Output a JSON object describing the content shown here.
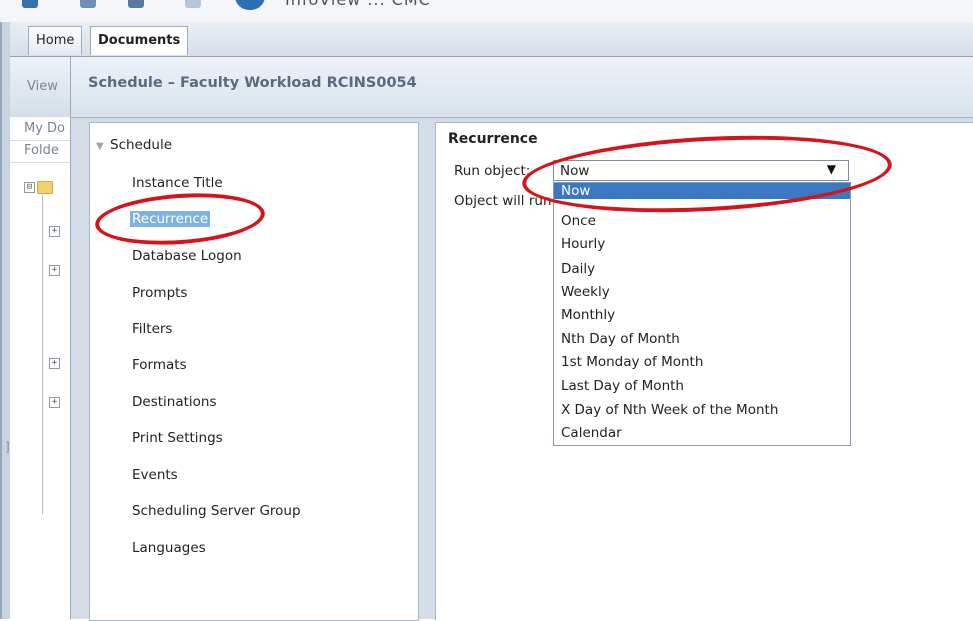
{
  "toolbar": {
    "app_title": "InfoView ... CMC"
  },
  "tabs": [
    {
      "label": "Home"
    },
    {
      "label": "Documents"
    }
  ],
  "docs_panel": {
    "view_label": "View",
    "my_documents": "My Do",
    "folders": "Folde",
    "expand_symbol": "⊟",
    "plus_symbol": "+"
  },
  "header": {
    "title": "Schedule – Faculty Workload RCINS0054"
  },
  "nav": {
    "root": "Schedule",
    "items": [
      {
        "label": "Instance Title"
      },
      {
        "label": "Recurrence",
        "selected": true
      },
      {
        "label": "Database Logon"
      },
      {
        "label": "Prompts"
      },
      {
        "label": "Filters"
      },
      {
        "label": "Formats"
      },
      {
        "label": "Destinations"
      },
      {
        "label": "Print Settings"
      },
      {
        "label": "Events"
      },
      {
        "label": "Scheduling Server Group"
      },
      {
        "label": "Languages"
      }
    ]
  },
  "recurrence": {
    "title": "Recurrence",
    "run_label": "Run object:",
    "will_run_label": "Object will run",
    "selected": "Now",
    "caret": "▼",
    "options": [
      "Now",
      "Once",
      "Hourly",
      "Daily",
      "Weekly",
      "Monthly",
      "Nth Day of Month",
      "1st Monday of Month",
      "Last Day of Month",
      "X Day of Nth Week of the Month",
      "Calendar"
    ]
  },
  "colors": {
    "annotation": "#d4141a",
    "highlight": "#3b78c4",
    "selected_nav": "#7fb1e3"
  }
}
